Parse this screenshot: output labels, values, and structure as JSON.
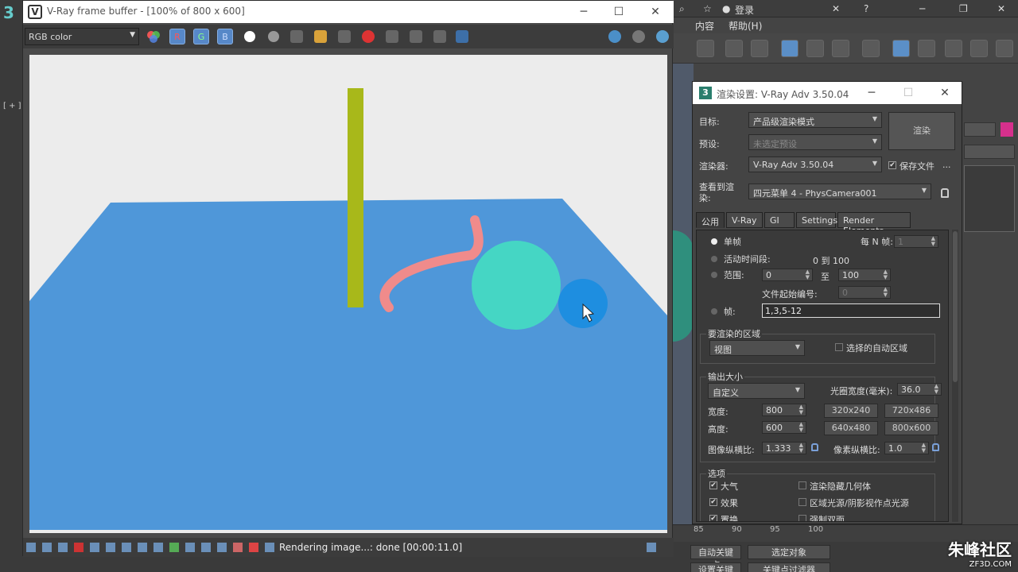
{
  "max": {
    "left_label": "[ + ]",
    "menu_top": [
      "登录"
    ],
    "menu2": [
      "内容",
      "帮助(H)"
    ],
    "timeline_numbers": [
      "85",
      "90",
      "95",
      "100"
    ],
    "status_buttons": {
      "auto_key": "自动关键点",
      "selected": "选定对象",
      "set_key": "设置关键点",
      "filters": "关键点过滤器"
    },
    "watermark": {
      "text": "朱峰社区",
      "sub": "ZF3D.COM"
    }
  },
  "vfb": {
    "title": "V-Ray frame buffer - [100% of 800 x 600]",
    "channel": "RGB color",
    "channel_buttons": [
      "R",
      "G",
      "B"
    ],
    "status_message": "Rendering image...: done [00:00:11.0]",
    "scene_colors": {
      "background": "#ececec",
      "plane": "#4f97d9",
      "pole": "#a8b81a",
      "sphere": "#45d6c4",
      "tube": "#f08b8b",
      "cursor_halo": "#1e8ee0"
    }
  },
  "render_setup": {
    "title": "渲染设置: V-Ray Adv 3.50.04",
    "target_label": "目标:",
    "target_value": "产品级渲染模式",
    "preset_label": "预设:",
    "preset_value": "未选定预设",
    "renderer_label": "渲染器:",
    "renderer_value": "V-Ray Adv 3.50.04",
    "save_file_label": "保存文件",
    "more": "...",
    "view_label": "查看到渲染:",
    "view_value": "四元菜单 4 - PhysCamera001",
    "render_button": "渲染",
    "tabs": [
      "公用",
      "V-Ray",
      "GI",
      "Settings",
      "Render Elements"
    ],
    "time_output": {
      "single": "单帧",
      "every_n": "每 N 帧:",
      "every_n_value": "1",
      "active_segment": "活动时间段:",
      "active_range": "0 到 100",
      "range": "范围:",
      "range_from": "0",
      "range_to_label": "至",
      "range_to": "100",
      "file_number": "文件起始编号:",
      "file_number_value": "0",
      "frames": "帧:",
      "frames_value": "1,3,5-12"
    },
    "area": {
      "title": "要渲染的区域",
      "value": "视图",
      "auto_region": "选择的自动区域"
    },
    "output_size": {
      "title": "输出大小",
      "mode": "自定义",
      "aperture_label": "光圈宽度(毫米):",
      "aperture": "36.0",
      "width_label": "宽度:",
      "width": "800",
      "height_label": "高度:",
      "height": "600",
      "presets": [
        "320x240",
        "720x486",
        "640x480",
        "800x600"
      ],
      "image_aspect_label": "图像纵横比:",
      "image_aspect": "1.333",
      "pixel_aspect_label": "像素纵横比:",
      "pixel_aspect": "1.0"
    },
    "options": {
      "title": "选项",
      "atmosphere": "大气",
      "effects": "效果",
      "displacement": "置换",
      "render_hidden": "渲染隐藏几何体",
      "area_lights": "区域光源/阴影视作点光源",
      "force_2sided": "强制双面"
    }
  }
}
